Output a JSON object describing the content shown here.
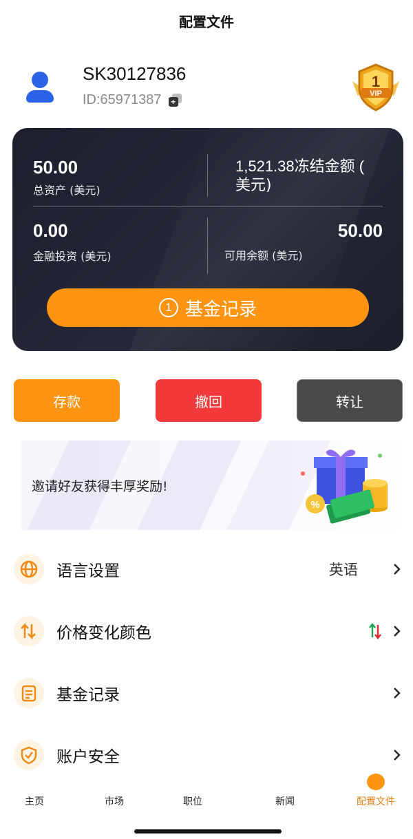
{
  "header": {
    "title": "配置文件"
  },
  "profile": {
    "username": "SK30127836",
    "id_text": "ID:65971387",
    "vip_level": "1",
    "vip_label": "VIP"
  },
  "balance": {
    "total_assets_value": "50.00",
    "total_assets_label": "总资产 (美元)",
    "frozen_amount_text": "1,521.38冻结金额 (",
    "frozen_amount_text2": "美元)",
    "financial_investment_value": "0.00",
    "financial_investment_label": "金融投资 (美元)",
    "available_balance_value": "50.00",
    "available_balance_label": "可用余额 (美元)",
    "fund_button_number": "1",
    "fund_button_label": "基金记录"
  },
  "actions": {
    "deposit": "存款",
    "withdraw": "撤回",
    "transfer": "转让"
  },
  "invite": {
    "text": "邀请好友获得丰厚奖励!"
  },
  "menu": [
    {
      "label": "语言设置",
      "value": "英语",
      "icon": "globe-icon"
    },
    {
      "label": "价格变化颜色",
      "value": "",
      "icon": "price-change-icon"
    },
    {
      "label": "基金记录",
      "value": "",
      "icon": "document-icon"
    },
    {
      "label": "账户安全",
      "value": "",
      "icon": "shield-check-icon"
    }
  ],
  "tabs": [
    {
      "label": "主页"
    },
    {
      "label": "市场"
    },
    {
      "label": "职位"
    },
    {
      "label": "新闻"
    },
    {
      "label": "配置文件"
    }
  ],
  "colors": {
    "accent": "#ff9412",
    "danger": "#f23a3a",
    "neutral": "#4a4a4a",
    "card_bg": "#1f2230",
    "up": "#1aa34a",
    "down": "#e02a2a"
  }
}
